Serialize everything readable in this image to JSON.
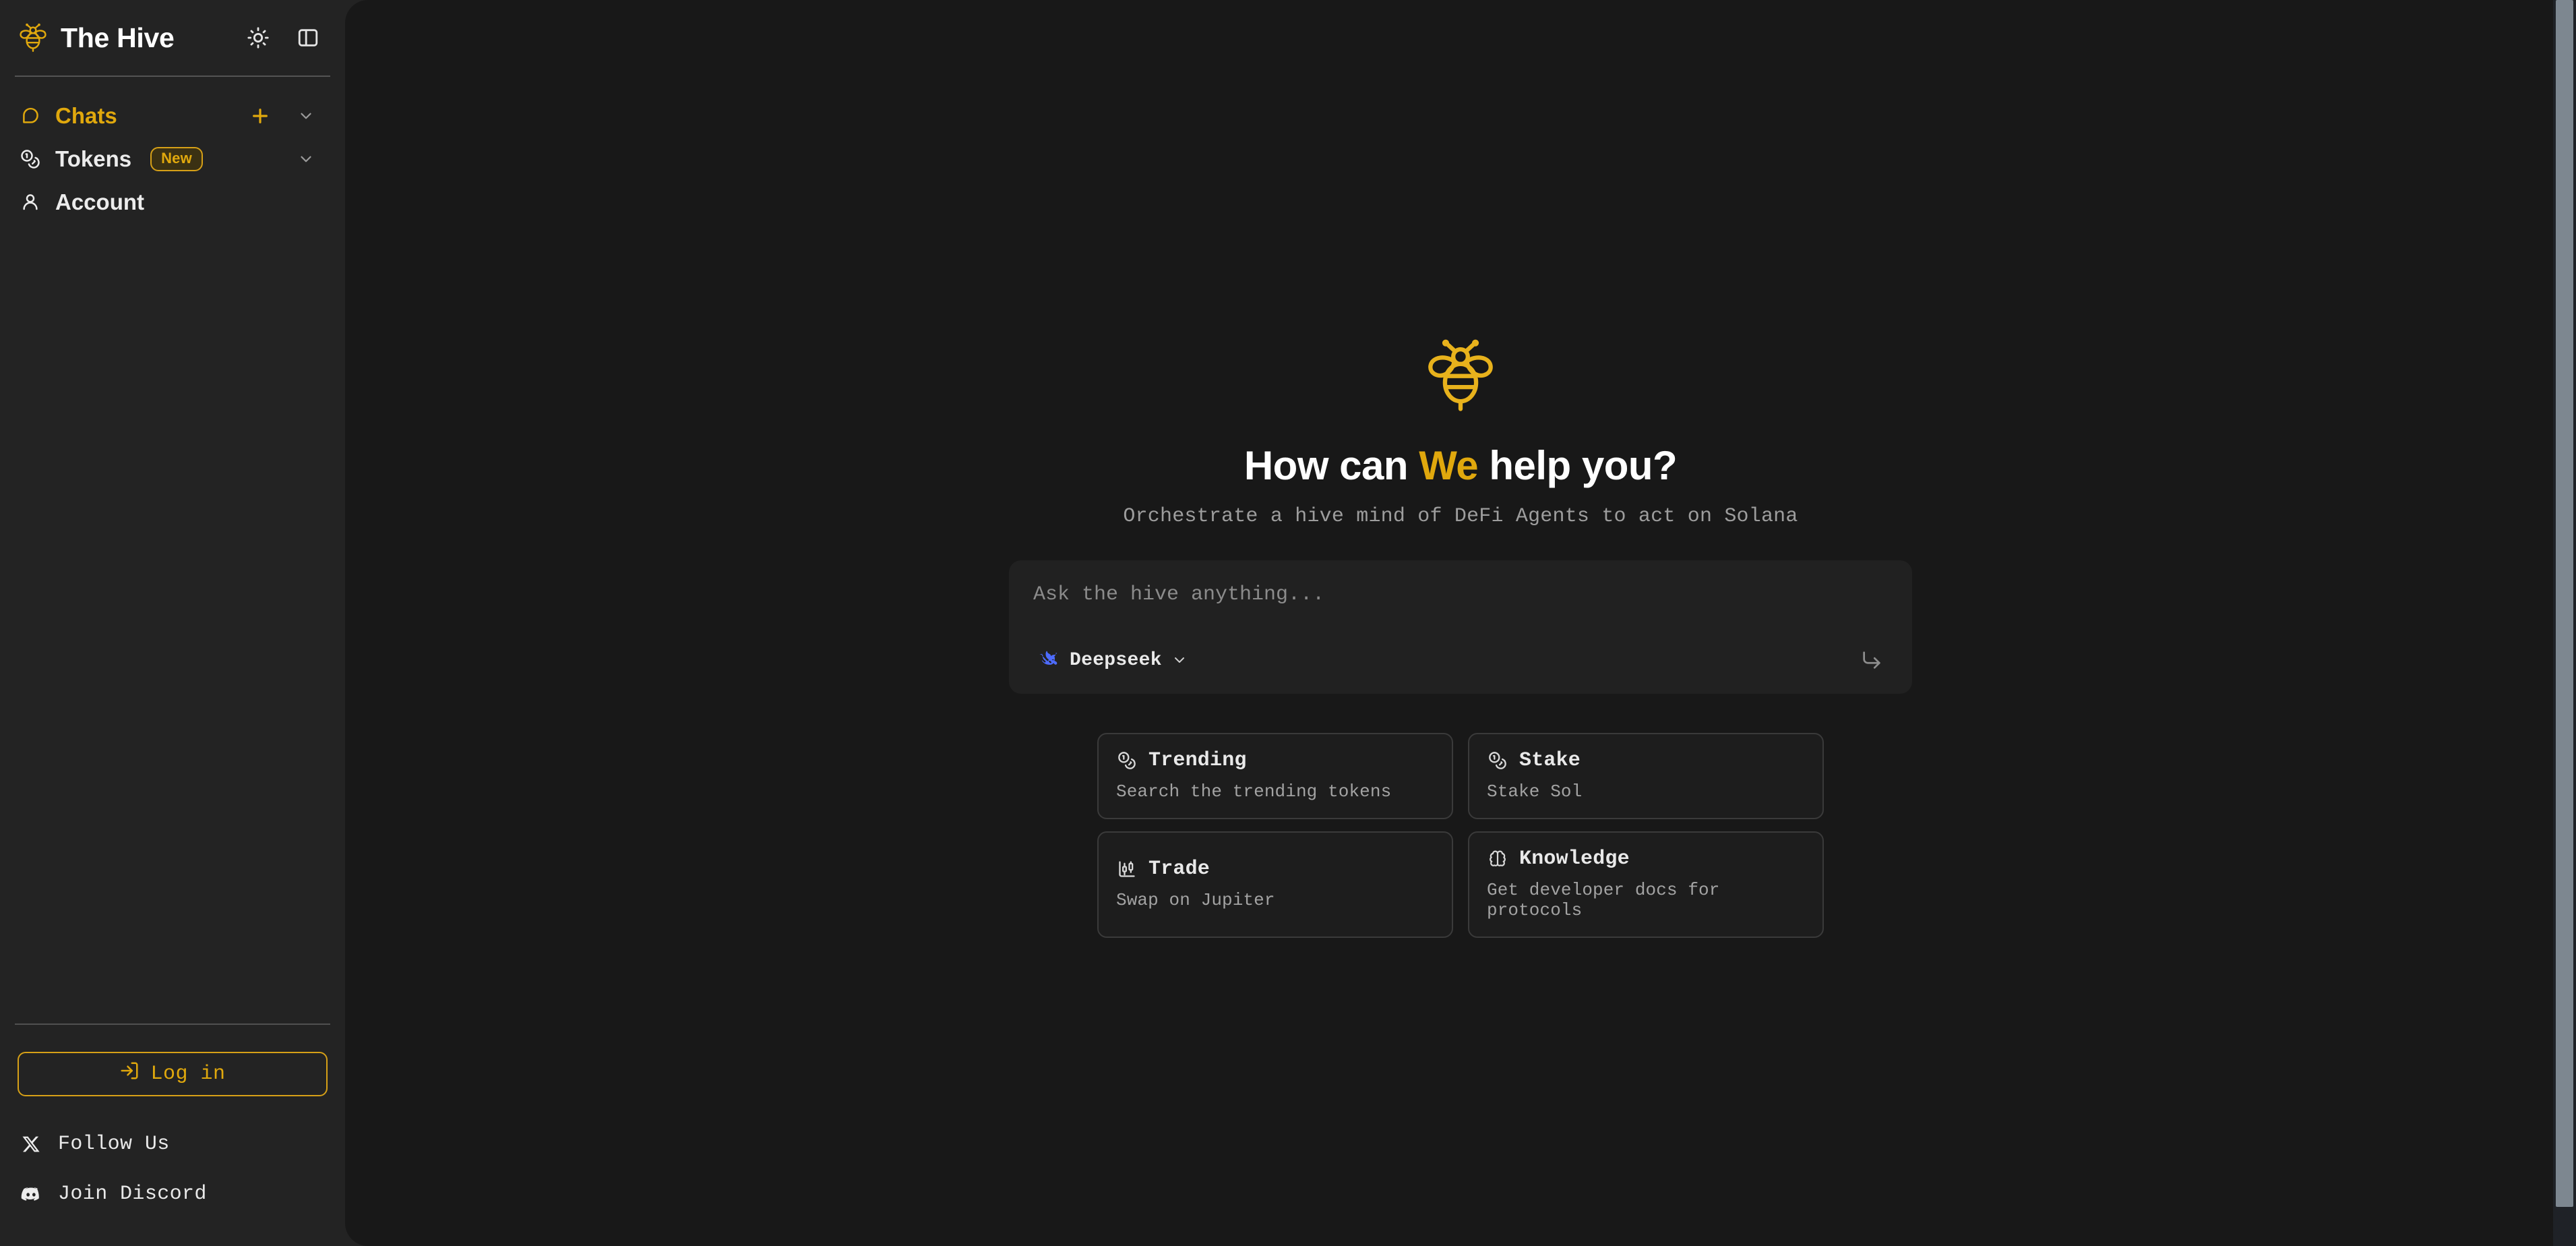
{
  "sidebar": {
    "brand": {
      "name": "The Hive",
      "logo_icon": "bee-icon"
    },
    "header_actions": [
      {
        "name": "theme-toggle",
        "icon": "sun-icon"
      },
      {
        "name": "sidebar-toggle",
        "icon": "panel-left-icon"
      }
    ],
    "nav": [
      {
        "label": "Chats",
        "icon": "message-square-icon",
        "accent": true,
        "actions": [
          {
            "name": "new-chat",
            "icon": "plus-icon"
          },
          {
            "name": "collapse",
            "icon": "chevron-down-icon"
          }
        ]
      },
      {
        "label": "Tokens",
        "icon": "coins-icon",
        "badge": "New",
        "accent": false,
        "actions": [
          {
            "name": "collapse",
            "icon": "chevron-down-icon"
          }
        ]
      },
      {
        "label": "Account",
        "icon": "user-icon",
        "accent": false,
        "actions": []
      }
    ],
    "login": {
      "label": "Log in",
      "icon": "log-in-icon"
    },
    "social": [
      {
        "label": "Follow Us",
        "icon": "x-twitter-icon"
      },
      {
        "label": "Join Discord",
        "icon": "discord-icon"
      }
    ]
  },
  "main": {
    "logo_icon": "bee-icon",
    "headline_before": "How can ",
    "headline_accent": "We",
    "headline_after": " help you?",
    "subtitle": "Orchestrate a hive mind of DeFi Agents to act on Solana",
    "composer": {
      "placeholder": "Ask the hive anything...",
      "value": "",
      "model": "Deepseek",
      "model_icon": "deepseek-whale-icon",
      "caret_icon": "chevron-down-icon",
      "send_icon": "corner-down-right-icon"
    },
    "suggestions": [
      {
        "title": "Trending",
        "subtitle": "Search the trending tokens",
        "icon": "coins-icon"
      },
      {
        "title": "Stake",
        "subtitle": "Stake Sol",
        "icon": "coins-icon"
      },
      {
        "title": "Trade",
        "subtitle": "Swap on Jupiter",
        "icon": "candlestick-chart-icon"
      },
      {
        "title": "Knowledge",
        "subtitle": "Get developer docs for protocols",
        "icon": "brain-icon"
      }
    ]
  },
  "colors": {
    "accent": "#e0a80d",
    "sidebar_bg": "#232323",
    "main_bg": "#181818",
    "composer_bg": "#212121",
    "card_border": "#3a3a3a",
    "deepseek_blue": "#4d6bfe",
    "scrollbar_thumb": "#7d8790"
  }
}
